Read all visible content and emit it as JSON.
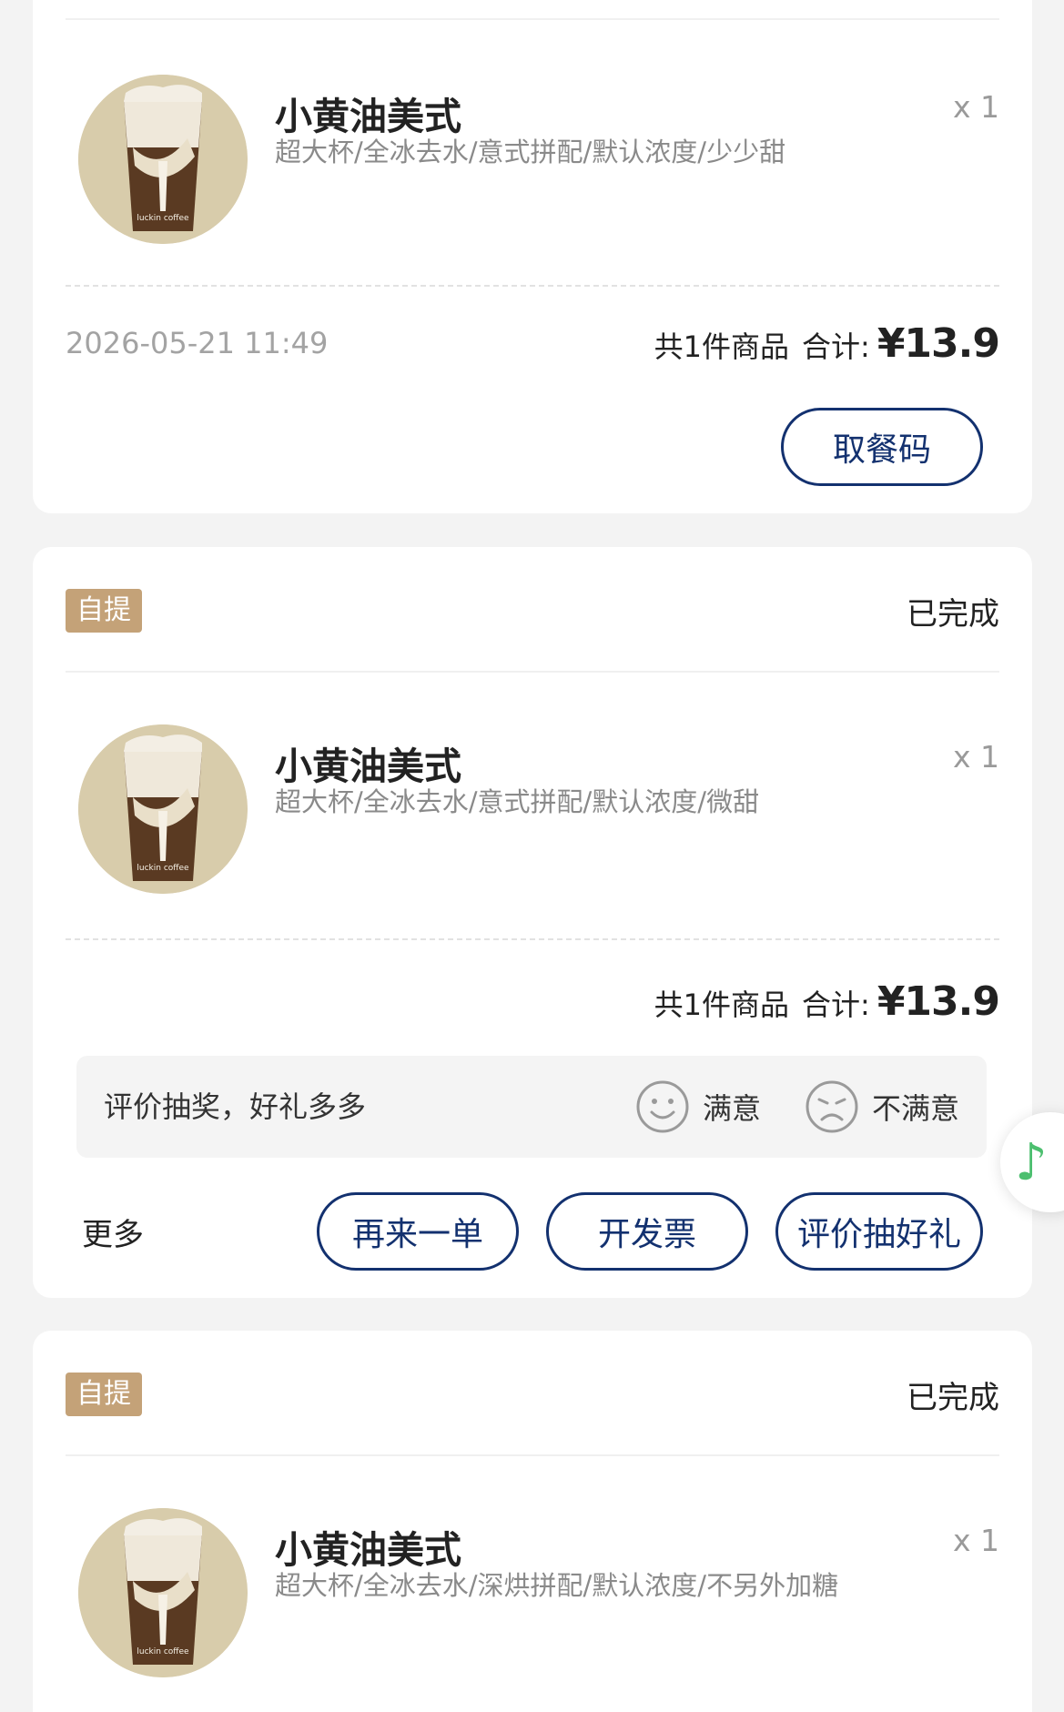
{
  "orders": [
    {
      "product": {
        "name": "小黄油美式",
        "spec": "超大杯/全冰去水/意式拼配/默认浓度/少少甜",
        "qty": "x 1",
        "brand_text": "luckin coffee"
      },
      "date": "2026-05-21 11:49",
      "count_label": "共1件商品",
      "sum_label": "合计:",
      "total": "¥13.9",
      "pickup_code_button": "取餐码"
    },
    {
      "tag": "自提",
      "status": "已完成",
      "product": {
        "name": "小黄油美式",
        "spec": "超大杯/全冰去水/意式拼配/默认浓度/微甜",
        "qty": "x 1",
        "brand_text": "luckin coffee"
      },
      "count_label": "共1件商品",
      "sum_label": "合计:",
      "total": "¥13.9",
      "rating": {
        "title": "评价抽奖，好礼多多",
        "satisfied": "满意",
        "unsatisfied": "不满意"
      },
      "more_label": "更多",
      "buttons": {
        "reorder": "再来一单",
        "invoice": "开发票",
        "review": "评价抽好礼"
      }
    },
    {
      "tag": "自提",
      "status": "已完成",
      "product": {
        "name": "小黄油美式",
        "spec": "超大杯/全冰去水/深烘拼配/默认浓度/不另外加糖",
        "qty": "x 1",
        "brand_text": "luckin coffee"
      }
    }
  ],
  "floating": {
    "music_icon": "♪"
  },
  "colors": {
    "tag_bg": "#c4a278",
    "button_border": "#13316f",
    "music_green": "#4cbf6f"
  }
}
